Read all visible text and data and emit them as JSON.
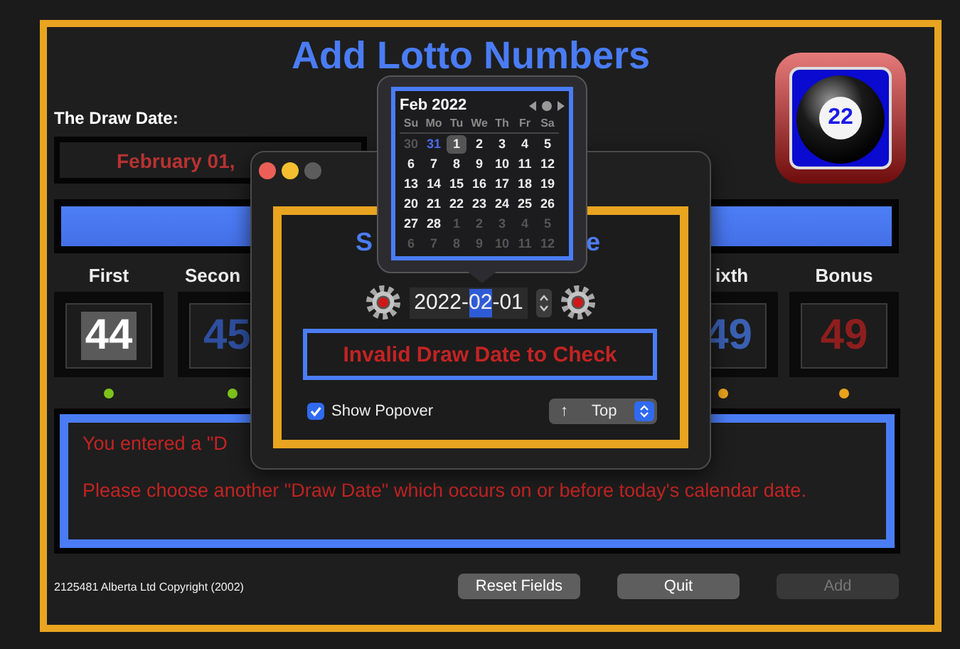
{
  "title": "Add Lotto Numbers",
  "draw_date": {
    "label": "The Draw Date:",
    "value": "February 01,"
  },
  "app_icon": {
    "number": "22"
  },
  "columns": [
    {
      "label": "First",
      "number": "44",
      "kind": "main",
      "selected": true,
      "color": "#7ec31c"
    },
    {
      "label": "Secon",
      "number": "45",
      "kind": "main",
      "selected": false,
      "color": "#7ec31c"
    },
    {
      "label": "ixth",
      "number": "49",
      "kind": "main",
      "selected": false,
      "color": "#e8a21c"
    },
    {
      "label": "Bonus",
      "number": "49",
      "kind": "bonus",
      "selected": false,
      "color": "#e8a21c"
    }
  ],
  "message": {
    "lines": [
      "You entered a \"D",
      "Please choose another \"Draw Date\" which occurs on or before today's calendar date."
    ]
  },
  "footer": {
    "copyright": "2125481 Alberta Ltd Copyright (2002)",
    "buttons": [
      {
        "label": "Reset Fields",
        "disabled": false
      },
      {
        "label": "Quit",
        "disabled": false
      },
      {
        "label": "Add",
        "disabled": true
      }
    ]
  },
  "dialog": {
    "heading_parts": [
      "S",
      "e"
    ],
    "date_segments": [
      {
        "text": "2022",
        "selected": false
      },
      {
        "text": "-",
        "selected": false
      },
      {
        "text": "02",
        "selected": true
      },
      {
        "text": "-",
        "selected": false
      },
      {
        "text": "01",
        "selected": false
      }
    ],
    "status": "Invalid Draw Date to Check",
    "show_popover": {
      "label": "Show Popover",
      "checked": true
    },
    "position_popup": {
      "arrow": "↑",
      "value": "Top"
    }
  },
  "calendar": {
    "month": "Feb 2022",
    "weekdays": [
      "Su",
      "Mo",
      "Tu",
      "We",
      "Th",
      "Fr",
      "Sa"
    ],
    "weeks": [
      [
        {
          "label": "30",
          "kind": "other",
          "selected": false
        },
        {
          "label": "31",
          "kind": "today",
          "selected": false
        },
        {
          "label": "1",
          "kind": "current",
          "selected": true
        },
        {
          "label": "2",
          "kind": "current",
          "selected": false
        },
        {
          "label": "3",
          "kind": "current",
          "selected": false
        },
        {
          "label": "4",
          "kind": "current",
          "selected": false
        },
        {
          "label": "5",
          "kind": "current",
          "selected": false
        }
      ],
      [
        {
          "label": "6",
          "kind": "current",
          "selected": false
        },
        {
          "label": "7",
          "kind": "current",
          "selected": false
        },
        {
          "label": "8",
          "kind": "current",
          "selected": false
        },
        {
          "label": "9",
          "kind": "current",
          "selected": false
        },
        {
          "label": "10",
          "kind": "current",
          "selected": false
        },
        {
          "label": "11",
          "kind": "current",
          "selected": false
        },
        {
          "label": "12",
          "kind": "current",
          "selected": false
        }
      ],
      [
        {
          "label": "13",
          "kind": "current",
          "selected": false
        },
        {
          "label": "14",
          "kind": "current",
          "selected": false
        },
        {
          "label": "15",
          "kind": "current",
          "selected": false
        },
        {
          "label": "16",
          "kind": "current",
          "selected": false
        },
        {
          "label": "17",
          "kind": "current",
          "selected": false
        },
        {
          "label": "18",
          "kind": "current",
          "selected": false
        },
        {
          "label": "19",
          "kind": "current",
          "selected": false
        }
      ],
      [
        {
          "label": "20",
          "kind": "current",
          "selected": false
        },
        {
          "label": "21",
          "kind": "current",
          "selected": false
        },
        {
          "label": "22",
          "kind": "current",
          "selected": false
        },
        {
          "label": "23",
          "kind": "current",
          "selected": false
        },
        {
          "label": "24",
          "kind": "current",
          "selected": false
        },
        {
          "label": "25",
          "kind": "current",
          "selected": false
        },
        {
          "label": "26",
          "kind": "current",
          "selected": false
        }
      ],
      [
        {
          "label": "27",
          "kind": "current",
          "selected": false
        },
        {
          "label": "28",
          "kind": "current",
          "selected": false
        },
        {
          "label": "1",
          "kind": "other",
          "selected": false
        },
        {
          "label": "2",
          "kind": "other",
          "selected": false
        },
        {
          "label": "3",
          "kind": "other",
          "selected": false
        },
        {
          "label": "4",
          "kind": "other",
          "selected": false
        },
        {
          "label": "5",
          "kind": "other",
          "selected": false
        }
      ],
      [
        {
          "label": "6",
          "kind": "other",
          "selected": false
        },
        {
          "label": "7",
          "kind": "other",
          "selected": false
        },
        {
          "label": "8",
          "kind": "other",
          "selected": false
        },
        {
          "label": "9",
          "kind": "other",
          "selected": false
        },
        {
          "label": "10",
          "kind": "other",
          "selected": false
        },
        {
          "label": "11",
          "kind": "other",
          "selected": false
        },
        {
          "label": "12",
          "kind": "other",
          "selected": false
        }
      ]
    ]
  }
}
